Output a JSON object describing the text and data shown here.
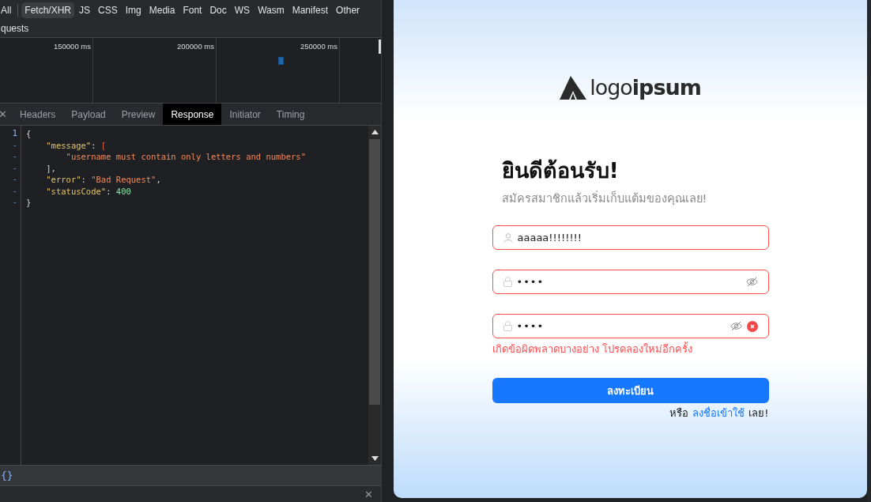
{
  "devtools": {
    "filters": [
      {
        "label": "All",
        "selected": false
      },
      {
        "label": "Fetch/XHR",
        "selected": true
      },
      {
        "label": "JS",
        "selected": false
      },
      {
        "label": "CSS",
        "selected": false
      },
      {
        "label": "Img",
        "selected": false
      },
      {
        "label": "Media",
        "selected": false
      },
      {
        "label": "Font",
        "selected": false
      },
      {
        "label": "Doc",
        "selected": false
      },
      {
        "label": "WS",
        "selected": false
      },
      {
        "label": "Wasm",
        "selected": false
      },
      {
        "label": "Manifest",
        "selected": false
      },
      {
        "label": "Other",
        "selected": false
      }
    ],
    "requests_label": "quests",
    "timeline_ticks": [
      "150000 ms",
      "200000 ms",
      "250000 ms"
    ],
    "close_label": "✕",
    "tabs": [
      {
        "label": "Headers",
        "selected": false
      },
      {
        "label": "Payload",
        "selected": false
      },
      {
        "label": "Preview",
        "selected": false
      },
      {
        "label": "Response",
        "selected": true
      },
      {
        "label": "Initiator",
        "selected": false
      },
      {
        "label": "Timing",
        "selected": false
      }
    ],
    "code_lines": [
      {
        "gutter": "1",
        "tokens": [
          {
            "kind": "punct",
            "text": "{"
          }
        ]
      },
      {
        "gutter": "-",
        "tokens": [
          {
            "kind": "key",
            "text": "    \"message\""
          },
          {
            "kind": "punct",
            "text": ": "
          },
          {
            "kind": "bracket",
            "text": "["
          }
        ]
      },
      {
        "gutter": "-",
        "tokens": [
          {
            "kind": "string",
            "text": "        \"username must contain only letters and numbers\""
          }
        ]
      },
      {
        "gutter": "-",
        "tokens": [
          {
            "kind": "punct",
            "text": "    ],"
          }
        ]
      },
      {
        "gutter": "-",
        "tokens": [
          {
            "kind": "key",
            "text": "    \"error\""
          },
          {
            "kind": "punct",
            "text": ": "
          },
          {
            "kind": "string",
            "text": "\"Bad Request\""
          },
          {
            "kind": "punct",
            "text": ","
          }
        ]
      },
      {
        "gutter": "-",
        "tokens": [
          {
            "kind": "key",
            "text": "    \"statusCode\""
          },
          {
            "kind": "punct",
            "text": ": "
          },
          {
            "kind": "number",
            "text": "400"
          }
        ]
      },
      {
        "gutter": "-",
        "tokens": [
          {
            "kind": "punct",
            "text": "}"
          }
        ]
      }
    ],
    "format_label": "{}",
    "drawer_close_label": "✕"
  },
  "app": {
    "logo_text": "logo**ipsum**",
    "title": "ยินดีต้อนรับ!",
    "subtitle": "สมัครสมาชิกแล้วเริ่มเก็บแต้มของคุณเลย!",
    "fields": [
      {
        "kind": "user",
        "value": "aaaaa!!!!!!!!",
        "error": true,
        "toggle": false,
        "clear": false
      },
      {
        "kind": "password",
        "value": "••••",
        "error": true,
        "toggle": true,
        "clear": false
      },
      {
        "kind": "password",
        "value": "••••",
        "error": true,
        "toggle": true,
        "clear": true
      }
    ],
    "error_message": "เกิดข้อผิดพลาดบางอย่าง โปรดลองใหม่อีกครั้ง",
    "submit_label": "ลงทะเบียน",
    "footer_prefix": "หรือ",
    "footer_link": "ลงชื่อเข้าใช้",
    "footer_suffix": "เลย!"
  }
}
